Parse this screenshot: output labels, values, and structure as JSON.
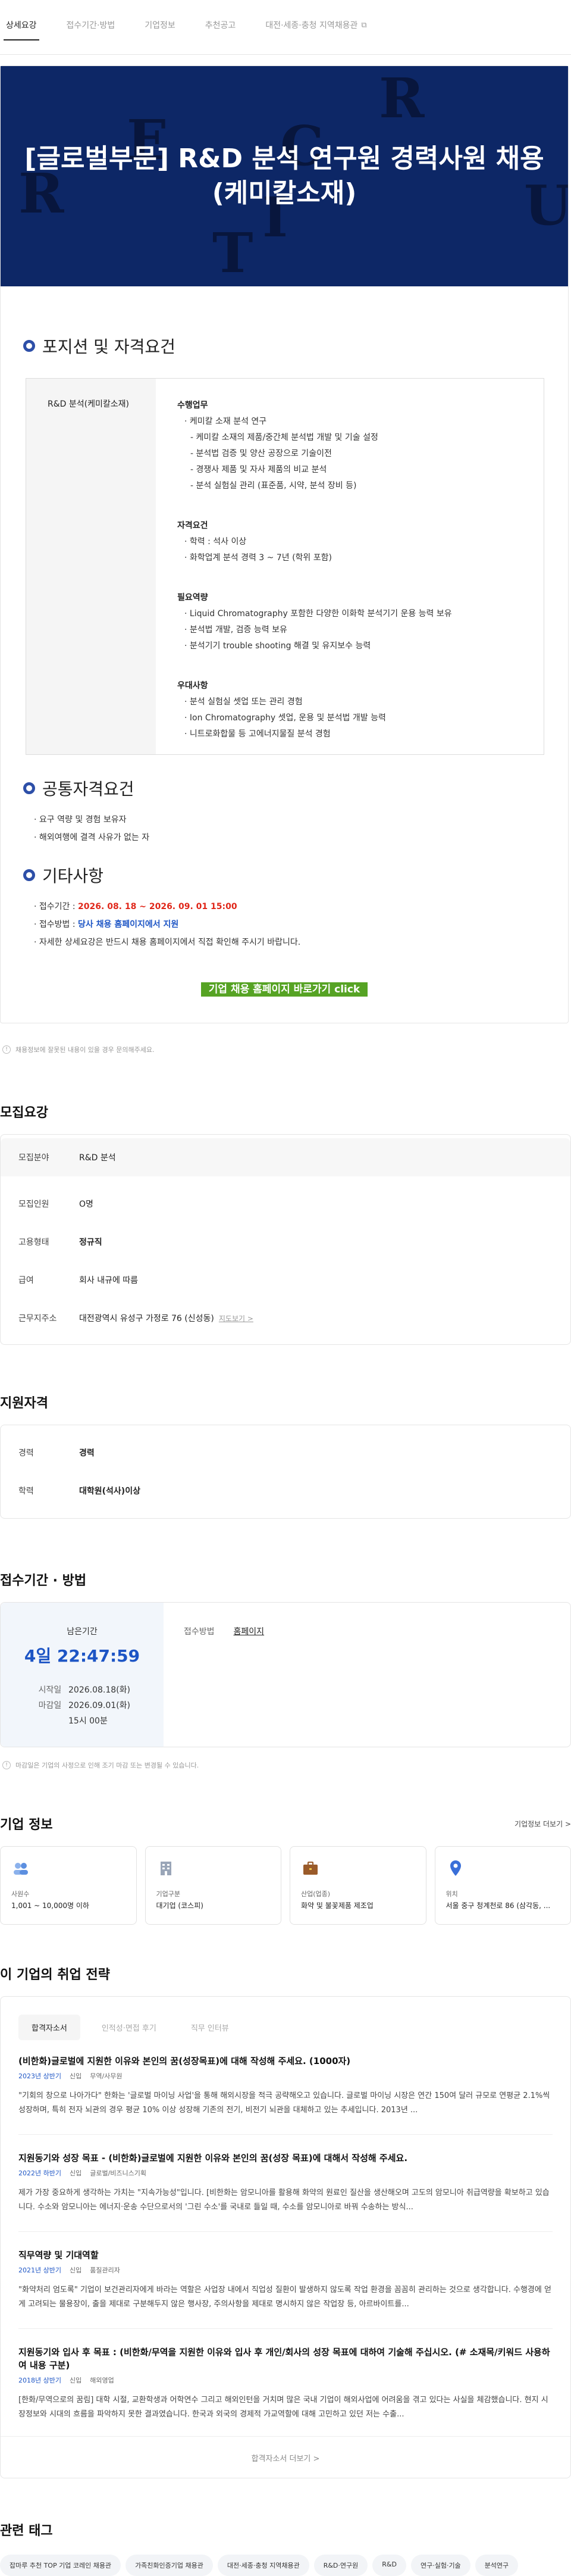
{
  "tabs": [
    {
      "label": "상세요강",
      "active": true
    },
    {
      "label": "접수기간·방법"
    },
    {
      "label": "기업정보"
    },
    {
      "label": "추천공고"
    },
    {
      "label": "대전·세종·충청 지역채용관"
    }
  ],
  "hero": {
    "title": "[글로벌부문] R&D 분석 연구원 경력사원 채용 (케미칼소재)",
    "letters": [
      "E",
      "R",
      "C",
      "R",
      "U",
      "I",
      "T"
    ]
  },
  "sections": {
    "position": "포지션 및 자격요건",
    "common": "공통자격요건",
    "etc": "기타사항"
  },
  "position": {
    "name": "R&D 분석(케미칼소재)",
    "groups": [
      {
        "title": "수행업무",
        "items": [
          "· 케미칼 소재 분석 연구",
          "- 케미칼 소재의 제품/중간체 분석법 개발 및 기술 설정",
          "- 분석법 검증 및 양산 공장으로 기술이전",
          "- 경쟁사 제품 및 자사 제품의 비교 분석",
          "- 분석 실험실 관리 (표준품, 시약, 분석 장비 등)"
        ]
      },
      {
        "title": "자격요건",
        "items": [
          "· 학력 : 석사 이상",
          "· 화학업계 분석 경력 3 ~ 7년 (학위 포함)"
        ]
      },
      {
        "title": "필요역량",
        "items": [
          "· Liquid Chromatography 포함한 다양한 이화학 분석기기 운용 능력 보유",
          "· 분석법 개발, 검증 능력 보유",
          "· 분석기기 trouble shooting 해결 및 유지보수 능력"
        ]
      },
      {
        "title": "우대사항",
        "items": [
          "· 분석 실험실 셋업 또는 관리 경험",
          "· Ion Chromatography 셋업, 운용 및 분석법 개발 능력",
          "· 니트로화합물 등 고에너지물질 분석 경험"
        ]
      }
    ]
  },
  "common_reqs": [
    "· 요구 역량 및 경험 보유자",
    "· 해외여행에 결격 사유가 없는 자"
  ],
  "etc": {
    "period_label": "· 접수기간 : ",
    "period_value": "2026. 08. 18 ~ 2026. 09. 01  15:00",
    "method_label": "· 접수방법 : ",
    "method_value": "당사 채용 홈페이지에서 지원",
    "detail": "· 자세한 상세요강은 반드시 채용 홈페이지에서 직접 확인해 주시기 바랍니다."
  },
  "cta_label": "기업 채용 홈페이지 바로가기 click",
  "report_note": "채용정보에 잘못된 내용이 있을 경우 문의해주세요.",
  "recruit_summary": {
    "title": "모집요강",
    "rows": [
      {
        "k": "모집분야",
        "v": "R&D 분석"
      },
      {
        "k": "모집인원",
        "v": "O명"
      },
      {
        "k": "고용형태",
        "v": "정규직"
      },
      {
        "k": "급여",
        "v": "회사 내규에 따름"
      },
      {
        "k": "근무지주소",
        "v": "대전광역시 유성구 가정로 76 (신성동)",
        "link": "지도보기 >"
      }
    ]
  },
  "qualification": {
    "title": "지원자격",
    "rows": [
      {
        "k": "경력",
        "v": "경력"
      },
      {
        "k": "학력",
        "v": "대학원(석사)이상"
      }
    ]
  },
  "apply": {
    "title": "접수기간 · 방법",
    "remain_label": "남은기간",
    "remain": "4일 22:47:59",
    "start_label": "시작일",
    "start": "2026.08.18(화)",
    "end_label": "마감일",
    "end": "2026.09.01(화)",
    "end_time": "15시 00분",
    "method_label": "접수방법",
    "method": "홈페이지",
    "note": "마감일은 기업의 사정으로 인해 조기 마감 또는 변경될 수 있습니다."
  },
  "company": {
    "title": "기업 정보",
    "more": "기업정보 더보기 >",
    "cards": [
      {
        "icon": "people-icon",
        "t": "사원수",
        "v": "1,001 ~ 10,000명 이하"
      },
      {
        "icon": "building-icon",
        "t": "기업구분",
        "v": "대기업 (코스피)"
      },
      {
        "icon": "briefcase-icon",
        "t": "산업(업종)",
        "v": "화약 및 불꽃제품 제조업"
      },
      {
        "icon": "location-icon",
        "t": "위치",
        "v": "서울 중구 청계천로 86 (삼각동, ..."
      }
    ]
  },
  "strategy": {
    "title": "이 기업의 취업 전략",
    "tabs": [
      "합격자소서",
      "인적성·면접 후기",
      "직무 인터뷰"
    ],
    "items": [
      {
        "title": "(비한화)글로벌에 지원한 이유와 본인의 꿈(성장목표)에 대해 작성해 주세요. (1000자)",
        "year": "2023년 상반기",
        "type": "신입",
        "dept": "무역/사무원",
        "body": "\"기회의 창으로 나아가다\" 한화는 '글로벌 마이닝 사업'을 통해 해외시장을 적극 공략해오고 있습니다. 글로벌 마이닝 시장은 연간 150여 달러 규모로 연평균 2.1%씩 성장하며, 특히 전자 뇌관의 경우 평균 10% 이상 성장해 기존의 전기, 비전기 뇌관을 대체하고 있는 추세입니다. 2013년 ..."
      },
      {
        "title": "지원동기와 성장 목표 - (비한화)글로벌에 지원한 이유와 본인의 꿈(성장 목표)에 대해서 작성해 주세요.",
        "year": "2022년 하반기",
        "type": "신입",
        "dept": "글로벌/비즈니스기획",
        "body": "제가 가장 중요하게 생각하는 가치는 \"지속가능성\"입니다. [비한화는 암모니아를 활용해 화약의 원료인 질산을 생산해오며 고도의 암모니아 취급역량을 확보하고 있습니다. 수소와 암모니아는 에너지·운송 수단으로서의 '그린 수소'를 국내로 들일 때, 수소를 암모니아로 바꿔 수송하는 방식..."
      },
      {
        "title": "직무역량 및 기대역할",
        "year": "2021년 상반기",
        "type": "신입",
        "dept": "품질관리자",
        "body": "\"화약처리 엄도록\" 기업이 보건관리자에게 바라는 역할은 사업장 내에서 직업성 질환이 발생하지 않도록 작업 환경을 꼼꼼히 관리하는 것으로 생각합니다. 수행경에 얻게 고려되는 물용장이, 출을 제대로 구분해두지 않은 행사장, 주의사항을 제대로 명시하지 않은 작업장 등, 아르바이트를..."
      },
      {
        "title": "지원동기와 입사 후 목표 : (비한화/무역을 지원한 이유와 입사 후 개인/회사의 성장 목표에 대하여 기술해 주십시오. (# 소재목/키워드 사용하여 내용 구분)",
        "year": "2018년 상반기",
        "type": "신입",
        "dept": "해외영업",
        "body": "[한화/무역으로의 꿈림] 대학 시절, 교환학생과 어학연수 그리고 해외인턴을 거치며 많은 국내 기업이 해외사업에 어려움을 겪고 있다는 사실을 체감했습니다. 현지 시장정보와 시대의 흐름을 파악하지 못한 결과였습니다. 한국과 외국의 경제적 가교역할에 대해 고민하고 있던 저는 수출..."
      }
    ],
    "more": "합격자소서 더보기 >"
  },
  "tags": {
    "title": "관련 태그",
    "items": [
      "잡마루 추천 TOP 기업 코레인 채용관",
      "가족친화인증기업 채용관",
      "대전·세종·충청 지역채용관",
      "R&D·연구원",
      "R&D",
      "연구·실험·기술",
      "분석연구"
    ]
  },
  "colors": {
    "hero_bg": "#0d2766",
    "accent": "#1d55c5",
    "cta": "#56a324",
    "red": "#e0271a"
  }
}
